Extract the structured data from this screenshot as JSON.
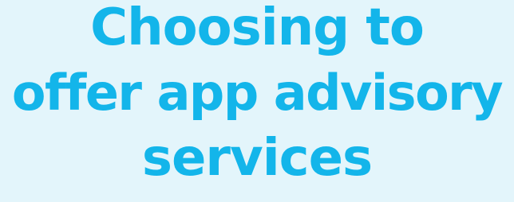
{
  "headline": {
    "lines": [
      "Choosing to",
      "offer app advisory",
      "services"
    ],
    "color": "#13b5ea"
  },
  "background_color": "#e3f5fb"
}
